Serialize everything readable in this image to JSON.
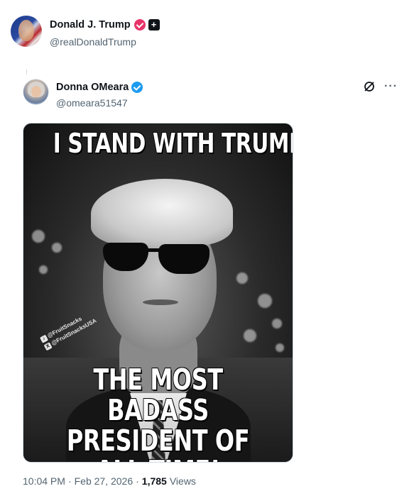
{
  "post": {
    "author_name": "Donald J. Trump",
    "author_handle": "@realDonaldTrump",
    "badge_icon": "pink-verified-badge-icon",
    "extra_badge": "+"
  },
  "quote": {
    "author_name": "Donna OMeara",
    "author_handle": "@omeara51547",
    "badge_icon": "blue-verified-badge-icon"
  },
  "meme": {
    "top_text": "I STAND WITH TRUMP",
    "bottom_text": "THE MOST BADASS PRESIDENT OF ALL TIME!",
    "watermark_1": "@FruitSnacks",
    "watermark_2": "@FruitSnacksUSA"
  },
  "meta": {
    "time": "10:04 PM",
    "date": "Feb 27, 2026",
    "separator": "·",
    "views_count": "1,785",
    "views_label": "Views"
  },
  "colors": {
    "text_primary": "#0f1419",
    "text_secondary": "#536471",
    "verified_blue": "#1d9bf0",
    "verified_pink": "#e8336a"
  }
}
